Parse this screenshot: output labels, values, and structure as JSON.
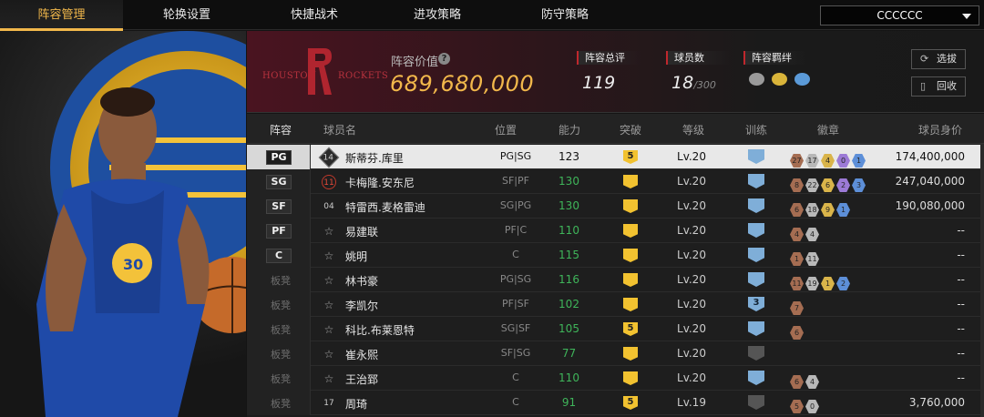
{
  "tabs": [
    {
      "label": "阵容管理",
      "active": true
    },
    {
      "label": "轮换设置",
      "active": false
    },
    {
      "label": "快捷战术",
      "active": false
    },
    {
      "label": "进攻策略",
      "active": false
    },
    {
      "label": "防守策略",
      "active": false
    }
  ],
  "team_select": {
    "value": "CCCCCC"
  },
  "header": {
    "logo_left": "HOUSTON",
    "logo_right": "ROCKETS",
    "value_label": "阵容价值",
    "value": "689,680,000",
    "rating_label": "阵容总评",
    "rating": "119",
    "players_label": "球员数",
    "players": "18",
    "players_max": "/300",
    "chemistry_label": "阵容羁绊",
    "select_button": "选拔",
    "recycle_button": "回收"
  },
  "columns": [
    "阵容",
    "球员名",
    "位置",
    "能力",
    "突破",
    "等级",
    "训练",
    "徽章",
    "球员身价"
  ],
  "rows": [
    {
      "slot": "PG",
      "starter": true,
      "jersey": "14",
      "jersey_style": "hex",
      "name": "斯蒂芬.库里",
      "position": "PG|SG",
      "ability": "123",
      "breakthrough": "5",
      "level": "Lv.20",
      "training": "",
      "badges": [
        {
          "t": "br",
          "v": "27"
        },
        {
          "t": "si",
          "v": "17"
        },
        {
          "t": "go",
          "v": "4"
        },
        {
          "t": "pu",
          "v": "0"
        },
        {
          "t": "bl",
          "v": "1"
        }
      ],
      "price": "174,400,000"
    },
    {
      "slot": "SG",
      "starter": true,
      "jersey": "11",
      "jersey_style": "red",
      "name": "卡梅隆.安东尼",
      "position": "SF|PF",
      "ability": "130",
      "breakthrough": "",
      "level": "Lv.20",
      "training": "",
      "badges": [
        {
          "t": "br",
          "v": "8"
        },
        {
          "t": "si",
          "v": "22"
        },
        {
          "t": "go",
          "v": "6"
        },
        {
          "t": "pu",
          "v": "2"
        },
        {
          "t": "bl",
          "v": "3"
        }
      ],
      "price": "247,040,000"
    },
    {
      "slot": "SF",
      "starter": true,
      "jersey": "04",
      "jersey_style": "plain",
      "name": "特雷西.麦格雷迪",
      "position": "SG|PG",
      "ability": "130",
      "breakthrough": "",
      "level": "Lv.20",
      "training": "",
      "badges": [
        {
          "t": "br",
          "v": "6"
        },
        {
          "t": "si",
          "v": "18"
        },
        {
          "t": "go",
          "v": "9"
        },
        {
          "t": "bl",
          "v": "1"
        }
      ],
      "price": "190,080,000"
    },
    {
      "slot": "PF",
      "starter": true,
      "jersey": "☆",
      "jersey_style": "star",
      "name": "易建联",
      "position": "PF|C",
      "ability": "110",
      "breakthrough": "",
      "level": "Lv.20",
      "training": "",
      "badges": [
        {
          "t": "br",
          "v": "4"
        },
        {
          "t": "si",
          "v": "4"
        }
      ],
      "price": "--"
    },
    {
      "slot": "C",
      "starter": true,
      "jersey": "☆",
      "jersey_style": "star",
      "name": "姚明",
      "position": "C",
      "ability": "115",
      "breakthrough": "",
      "level": "Lv.20",
      "training": "",
      "badges": [
        {
          "t": "br",
          "v": "1"
        },
        {
          "t": "si",
          "v": "11"
        }
      ],
      "price": "--"
    },
    {
      "slot": "板凳",
      "starter": false,
      "jersey": "☆",
      "jersey_style": "star",
      "name": "林书豪",
      "position": "PG|SG",
      "ability": "116",
      "breakthrough": "",
      "level": "Lv.20",
      "training": "",
      "badges": [
        {
          "t": "br",
          "v": "11"
        },
        {
          "t": "si",
          "v": "19"
        },
        {
          "t": "go",
          "v": "1"
        },
        {
          "t": "bl",
          "v": "2"
        }
      ],
      "price": "--"
    },
    {
      "slot": "板凳",
      "starter": false,
      "jersey": "☆",
      "jersey_style": "star",
      "name": "李凯尔",
      "position": "PF|SF",
      "ability": "102",
      "breakthrough": "",
      "level": "Lv.20",
      "training": "3",
      "badges": [
        {
          "t": "br",
          "v": "7"
        }
      ],
      "price": "--"
    },
    {
      "slot": "板凳",
      "starter": false,
      "jersey": "☆",
      "jersey_style": "star",
      "name": "科比.布莱恩特",
      "position": "SG|SF",
      "ability": "105",
      "breakthrough": "5",
      "level": "Lv.20",
      "training": "",
      "badges": [
        {
          "t": "br",
          "v": "6"
        }
      ],
      "price": "--"
    },
    {
      "slot": "板凳",
      "starter": false,
      "jersey": "☆",
      "jersey_style": "star",
      "name": "崔永熙",
      "position": "SF|SG",
      "ability": "77",
      "breakthrough": "",
      "level": "Lv.20",
      "training": "gray",
      "badges": [],
      "price": "--"
    },
    {
      "slot": "板凳",
      "starter": false,
      "jersey": "☆",
      "jersey_style": "star",
      "name": "王治郅",
      "position": "C",
      "ability": "110",
      "breakthrough": "",
      "level": "Lv.20",
      "training": "",
      "badges": [
        {
          "t": "br",
          "v": "6"
        },
        {
          "t": "si",
          "v": "4"
        }
      ],
      "price": "--"
    },
    {
      "slot": "板凳",
      "starter": false,
      "jersey": "17",
      "jersey_style": "plain",
      "name": "周琦",
      "position": "C",
      "ability": "91",
      "breakthrough": "5",
      "level": "Lv.19",
      "training": "gray",
      "badges": [
        {
          "t": "br",
          "v": "5"
        },
        {
          "t": "si",
          "v": "0"
        }
      ],
      "price": "3,760,000"
    }
  ]
}
